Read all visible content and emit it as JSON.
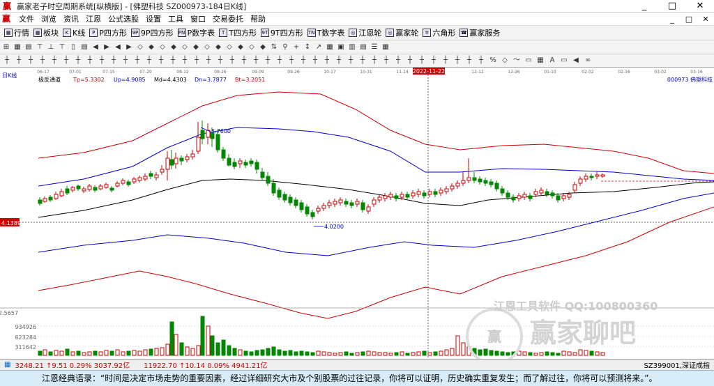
{
  "window": {
    "title": "赢家老子时空周期系统[纵横版] - [佛塑科技 SZ000973-184日K线]",
    "controls": [
      "_",
      "□",
      "✕"
    ]
  },
  "menu": {
    "items": [
      "文件",
      "浏览",
      "资讯",
      "江恩",
      "公式选股",
      "设置",
      "工具",
      "窗口",
      "交易委托",
      "帮助"
    ],
    "win_ctl": [
      "_",
      "□",
      "✕"
    ]
  },
  "toolbar1": {
    "items": [
      "行情",
      "板块",
      "K线",
      "P四方形",
      "9P四方形",
      "P数字表",
      "T四方形",
      "9T四方形",
      "T数字表",
      "江恩轮",
      "赢家轮",
      "六角形",
      "赢家服务"
    ]
  },
  "toolbar2": {
    "icons": [
      "⊞",
      "▦",
      "▤",
      "⊤",
      "⊥",
      "⊤",
      "▯",
      "▤",
      "◀",
      "▶",
      "◀",
      "▶",
      "◇",
      "◆",
      "◇",
      "◆",
      "◇",
      "◆",
      "◇",
      "◆",
      "◇",
      "◆",
      "◇",
      "◆",
      "⇅",
      "⚲",
      "+",
      "↕",
      "↗",
      "▦",
      "▣",
      "▥",
      "▤",
      "☰",
      "▦"
    ]
  },
  "toolbar3": {
    "icons": [
      "┼",
      "┼",
      "┼",
      "┼",
      "┼",
      "┼",
      "┼",
      "┼",
      "┼",
      "┼",
      "┼",
      "┼",
      "┼",
      "┼",
      "┼",
      "┼",
      "┼",
      "┼",
      "┼",
      "┼",
      "┼",
      "┼",
      "┼",
      "┼",
      "┼",
      "┼",
      "┼",
      "┼",
      "┼",
      "┼",
      "┼",
      "┼",
      "┼",
      "┼",
      "┼",
      "┼",
      "┼",
      "┼",
      "┼",
      "┼",
      "┼",
      "%",
      "◇",
      "〜",
      "▭",
      "▦",
      "A",
      "▭",
      "◀",
      "∞"
    ]
  },
  "chart": {
    "period_label": "日K线",
    "indicator_name": "极反通道",
    "params": [
      {
        "label": "Tp=5.3302",
        "color": "#cc0000"
      },
      {
        "label": "Up=4.9085",
        "color": "#0000cc"
      },
      {
        "label": "Md=4.4303",
        "color": "#000000"
      },
      {
        "label": "Dn=3.7877",
        "color": "#0000cc"
      },
      {
        "label": "Bt=3.2051",
        "color": "#cc0000"
      }
    ],
    "stock_label": "000973 佛塑科技",
    "dates": [
      "06-17",
      "07-01",
      "07-15",
      "07-29",
      "08-12",
      "08-26",
      "09-09",
      "09-26",
      "10-17",
      "10-31",
      "11-14",
      "2022-11-22",
      "12-12",
      "12-26",
      "01-10",
      "02-02",
      "02-16",
      "03-02",
      "03-16"
    ],
    "price_label": "4.1389",
    "high_label": "5.7600",
    "low_label": "4.0200",
    "vol_axis": [
      "2.5657",
      "934926",
      "623284",
      "311642"
    ]
  },
  "status": {
    "items": [
      {
        "text": "3248.21 ↑9.51 0.29% 3037.92亿",
        "color": "#cc0000"
      },
      {
        "text": "11922.70 ↑10.14 0.09% 4941.21亿",
        "color": "#cc0000"
      },
      {
        "text": "SZ399001,深证成指",
        "color": "#000000"
      }
    ]
  },
  "watermark": {
    "line1": "江恩工具软件 QQ:100800360",
    "line2": "赢家聊吧",
    "logo": "赢"
  },
  "quote": "江恩经典语录：“时间是决定市场走势的重要因素，经过详细研究大市及个别股票的过往记录，你将可以证明，历史确实重复发生；而了解过往，你将可以预测将来。”。"
}
